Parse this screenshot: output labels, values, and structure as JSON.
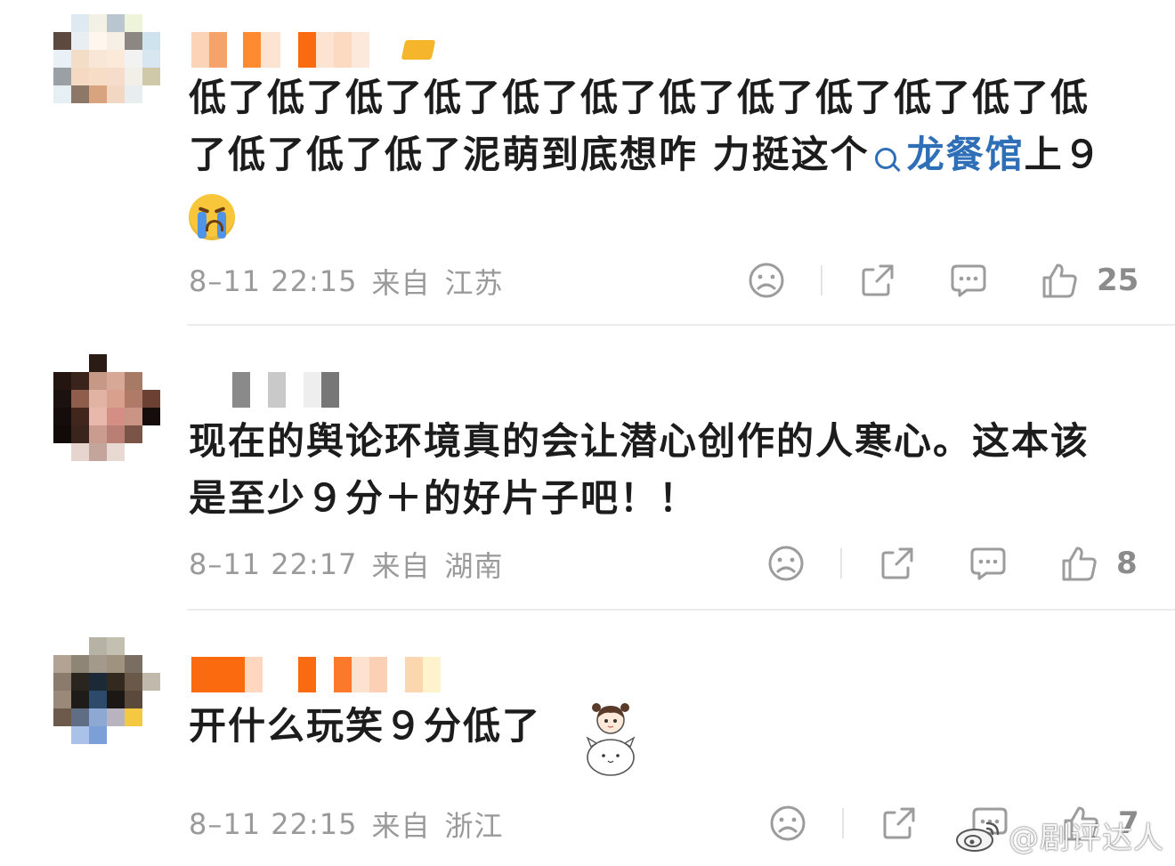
{
  "colors": {
    "text_main": "#1c1c1c",
    "text_meta": "#9a9a9a",
    "link_blue": "#2f6fb7",
    "icon_gray": "#9c9c9c",
    "divider": "#ececec"
  },
  "comments": [
    {
      "text_line1": "低了低了低了低了低了低了低了低了低了低了低了低",
      "text_line2": "了低了低了低了泥萌到底想咋 力挺这个",
      "search_link": "龙餐馆",
      "text_after_link": "上９",
      "emoji": "loudly-crying-face-emoji",
      "date": "8–11 22:15",
      "from_label": "来自",
      "location": "江苏",
      "like_count": "25"
    },
    {
      "text_line1": "现在的舆论环境真的会让潜心创作的人寒心。这本该",
      "text_line2": "是至少９分＋的好片子吧！！",
      "date": "8–11 22:17",
      "from_label": "来自",
      "location": "湖南",
      "like_count": "8"
    },
    {
      "text_line1": "开什么玩笑９分低了",
      "sticker": "girl-with-cat-sticker",
      "date": "8–11 22:15",
      "from_label": "来自",
      "location": "浙江",
      "like_count": "7"
    }
  ],
  "icons": {
    "dislike": "frown-face-icon",
    "share": "share-icon",
    "reply": "comment-bubble-icon",
    "like": "thumbs-up-icon"
  },
  "watermark": {
    "logo": "weibo-logo",
    "text": "@剧评达人"
  }
}
